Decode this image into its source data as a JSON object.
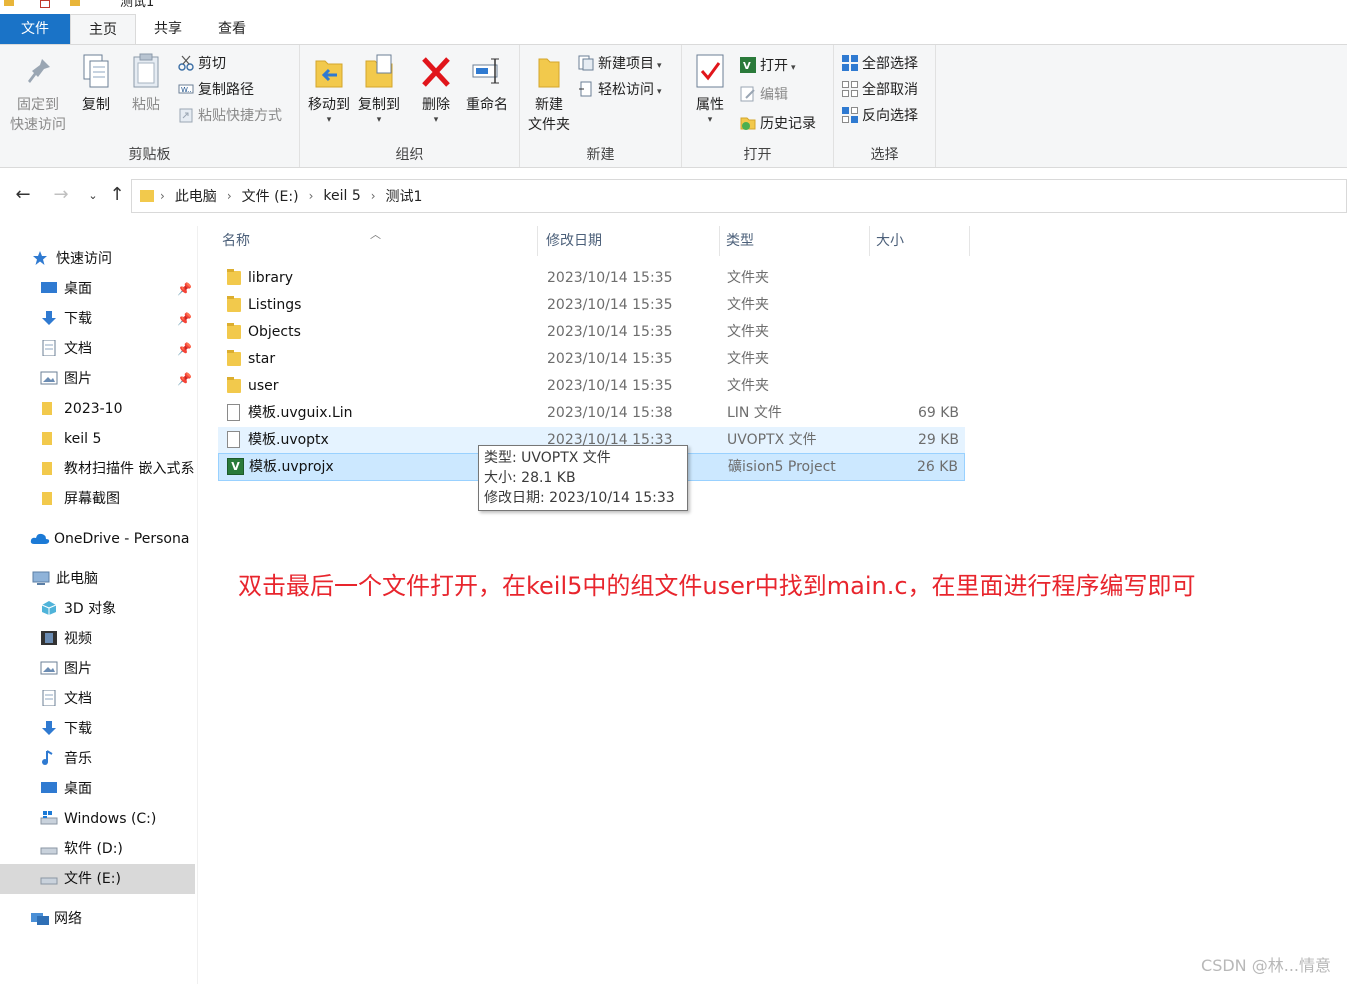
{
  "window": {
    "title": "测试1"
  },
  "tabs": [
    {
      "label": "文件"
    },
    {
      "label": "主页"
    },
    {
      "label": "共享"
    },
    {
      "label": "查看"
    }
  ],
  "ribbon": {
    "clipboard": {
      "label": "剪贴板",
      "pin_line1": "固定到",
      "pin_line2": "快速访问",
      "copy": "复制",
      "paste": "粘贴",
      "cut": "剪切",
      "copy_path": "复制路径",
      "paste_shortcut": "粘贴快捷方式"
    },
    "organize": {
      "label": "组织",
      "move_to": "移动到",
      "copy_to": "复制到",
      "delete": "删除",
      "rename": "重命名"
    },
    "new": {
      "label": "新建",
      "new_folder_line1": "新建",
      "new_folder_line2": "文件夹",
      "new_item": "新建项目",
      "easy_access": "轻松访问"
    },
    "open": {
      "label": "打开",
      "properties": "属性",
      "open": "打开",
      "edit": "编辑",
      "history": "历史记录"
    },
    "select": {
      "label": "选择",
      "select_all": "全部选择",
      "select_none": "全部取消",
      "invert": "反向选择"
    }
  },
  "breadcrumb": [
    "此电脑",
    "文件 (E:)",
    "keil 5",
    "测试1"
  ],
  "nav": {
    "quick_access": "快速访问",
    "quick_items": [
      {
        "label": "桌面",
        "pinned": true
      },
      {
        "label": "下载",
        "pinned": true
      },
      {
        "label": "文档",
        "pinned": true
      },
      {
        "label": "图片",
        "pinned": true
      },
      {
        "label": "2023-10",
        "pinned": false
      },
      {
        "label": "keil 5",
        "pinned": false
      },
      {
        "label": "教材扫描件 嵌入式系",
        "pinned": false
      },
      {
        "label": "屏幕截图",
        "pinned": false
      }
    ],
    "onedrive": "OneDrive - Persona",
    "this_pc": "此电脑",
    "pc_items": [
      "3D 对象",
      "视频",
      "图片",
      "文档",
      "下载",
      "音乐",
      "桌面",
      "Windows (C:)",
      "软件 (D:)",
      "文件 (E:)"
    ],
    "network": "网络"
  },
  "columns": {
    "name": "名称",
    "date": "修改日期",
    "type": "类型",
    "size": "大小"
  },
  "files": [
    {
      "name": "library",
      "date": "2023/10/14 15:35",
      "type": "文件夹",
      "size": "",
      "icon": "folder"
    },
    {
      "name": "Listings",
      "date": "2023/10/14 15:35",
      "type": "文件夹",
      "size": "",
      "icon": "folder"
    },
    {
      "name": "Objects",
      "date": "2023/10/14 15:35",
      "type": "文件夹",
      "size": "",
      "icon": "folder"
    },
    {
      "name": "star",
      "date": "2023/10/14 15:35",
      "type": "文件夹",
      "size": "",
      "icon": "folder"
    },
    {
      "name": "user",
      "date": "2023/10/14 15:35",
      "type": "文件夹",
      "size": "",
      "icon": "folder"
    },
    {
      "name": "模板.uvguix.Lin",
      "date": "2023/10/14 15:38",
      "type": "LIN 文件",
      "size": "69 KB",
      "icon": "document"
    },
    {
      "name": "模板.uvoptx",
      "date": "2023/10/14 15:33",
      "type": "UVOPTX 文件",
      "size": "29 KB",
      "icon": "document"
    },
    {
      "name": "模板.uvprojx",
      "date": "",
      "type": "礦ision5 Project",
      "size": "26 KB",
      "icon": "uvision"
    }
  ],
  "tooltip": {
    "line1": "类型: UVOPTX 文件",
    "line2": "大小: 28.1 KB",
    "line3": "修改日期: 2023/10/14 15:33"
  },
  "annotation": "双击最后一个文件打开，在keil5中的组文件user中找到main.c，在里面进行程序编写即可",
  "watermark": "CSDN @林...情意",
  "colors": {
    "file_tab": "#1a73c7",
    "annotation": "#e8252d",
    "selection": "#cce8ff"
  }
}
